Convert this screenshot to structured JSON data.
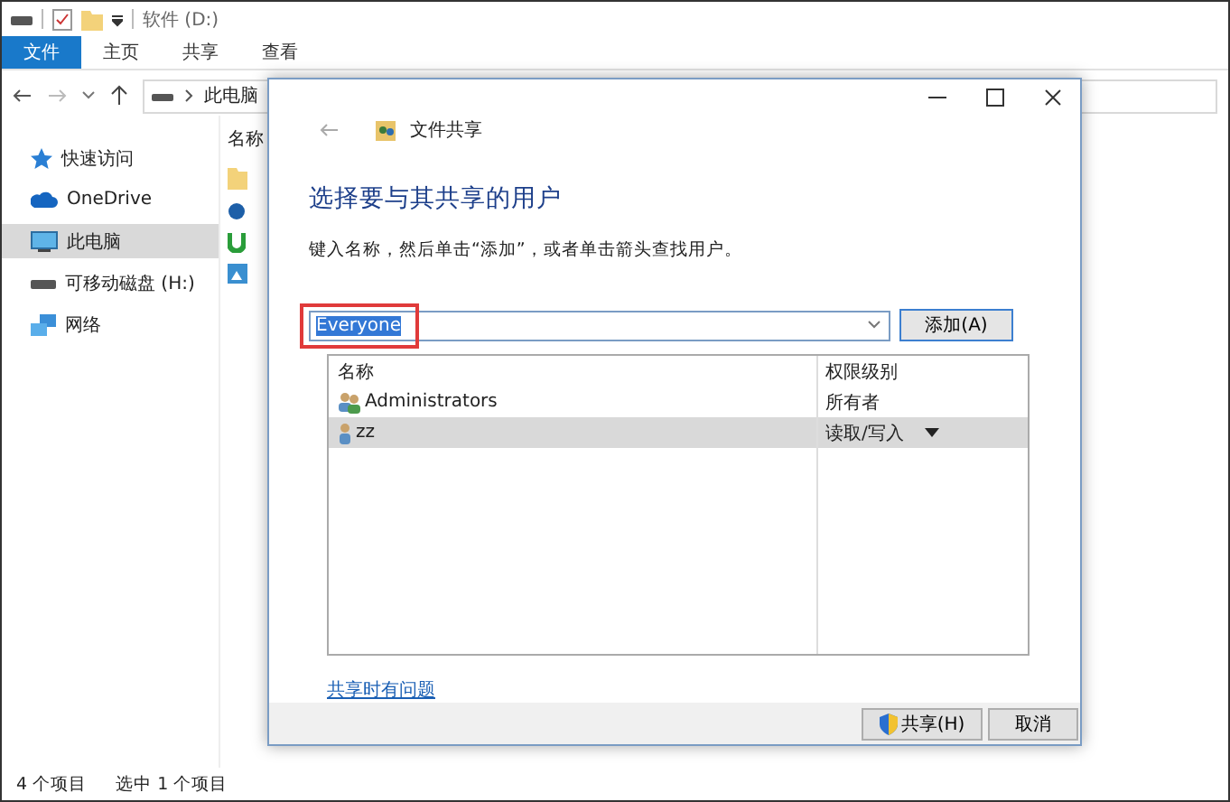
{
  "explorer": {
    "title": "软件 (D:)",
    "ribbon_tabs": [
      {
        "label": "文件",
        "selected": true
      },
      {
        "label": "主页",
        "selected": false
      },
      {
        "label": "共享",
        "selected": false
      },
      {
        "label": "查看",
        "selected": false
      }
    ],
    "address": "此电脑",
    "nav": [
      {
        "label": "快速访问",
        "kind": "star",
        "selected": false
      },
      {
        "label": "OneDrive",
        "kind": "cloud",
        "selected": false
      },
      {
        "label": "此电脑",
        "kind": "pc",
        "selected": true
      },
      {
        "label": "可移动磁盘 (H:)",
        "kind": "drive",
        "selected": false
      },
      {
        "label": "网络",
        "kind": "network",
        "selected": false
      }
    ],
    "column_header": "名称",
    "status": [
      "4 个项目",
      "选中 1 个项目"
    ]
  },
  "dialog": {
    "title": "文件共享",
    "heading": "选择要与其共享的用户",
    "instruction": "键入名称，然后单击“添加”，或者单击箭头查找用户。",
    "name_field": {
      "value": "Everyone",
      "highlighted": true
    },
    "add_button": "添加(A)",
    "columns": [
      "名称",
      "权限级别"
    ],
    "rows": [
      {
        "name": "Administrators",
        "kind": "group",
        "permission": "所有者",
        "has_menu": false,
        "selected": false
      },
      {
        "name": "zz",
        "kind": "user",
        "permission": "读取/写入",
        "has_menu": true,
        "selected": true
      }
    ],
    "help_link": "共享时有问题",
    "buttons": [
      {
        "label": "共享(H)",
        "kind": "shield"
      },
      {
        "label": "取消",
        "kind": "plain"
      }
    ]
  }
}
